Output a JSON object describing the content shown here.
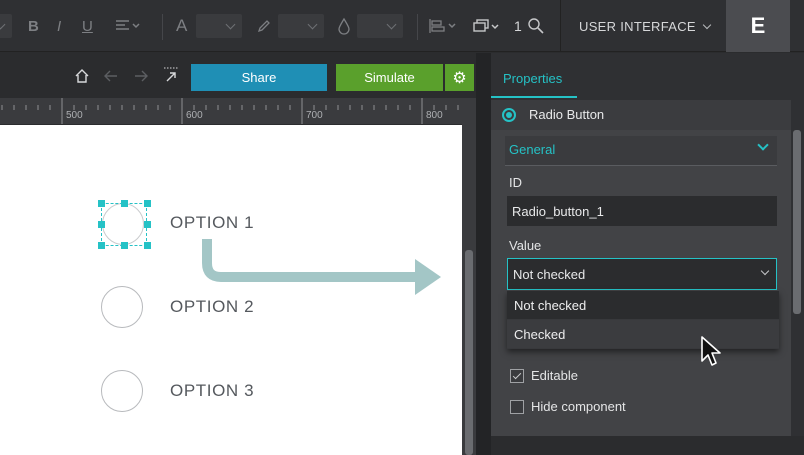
{
  "toolbar": {
    "bold_label": "B",
    "italic_label": "I",
    "underline_label": "U",
    "font_icon_label": "A",
    "zoom_value": "1",
    "product_area_label": "USER INTERFACE",
    "logo_letter": "E"
  },
  "nav": {
    "share_label": "Share",
    "simulate_label": "Simulate"
  },
  "ruler": {
    "ticks": [
      "500",
      "600",
      "700",
      "800"
    ]
  },
  "canvas": {
    "options": [
      {
        "label": "OPTION 1",
        "selected": true
      },
      {
        "label": "OPTION 2",
        "selected": false
      },
      {
        "label": "OPTION 3",
        "selected": false
      }
    ],
    "arrow_color": "#a3c6c6",
    "selection_color": "#25c2c6"
  },
  "properties": {
    "tab_label": "Properties",
    "component_name": "Radio Button",
    "section_label": "General",
    "id_label": "ID",
    "id_value": "Radio_button_1",
    "value_label": "Value",
    "value_selected": "Not checked",
    "value_options": [
      "Not checked",
      "Checked"
    ],
    "editable_label": "Editable",
    "editable_checked": true,
    "hide_label": "Hide component",
    "hide_checked": false
  },
  "colors": {
    "accent": "#25c2c6",
    "share": "#1f8fb5",
    "simulate": "#5aa02c"
  }
}
